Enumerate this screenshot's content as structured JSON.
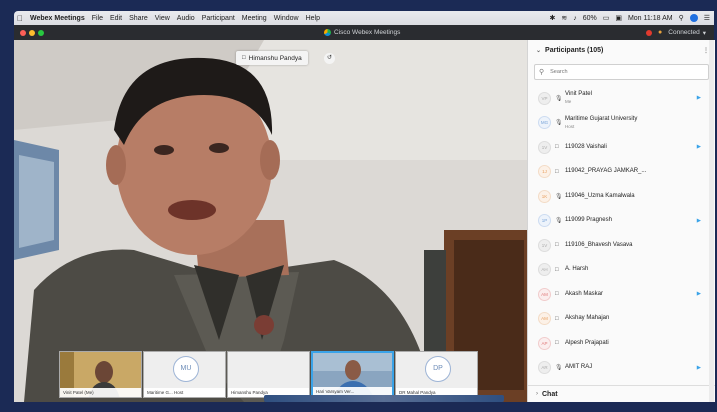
{
  "menubar": {
    "app": "Webex Meetings",
    "items": [
      "File",
      "Edit",
      "Share",
      "View",
      "Audio",
      "Participant",
      "Meeting",
      "Window",
      "Help"
    ],
    "battery": "60%",
    "clock": "Mon 11:18 AM"
  },
  "window": {
    "title": "Cisco Webex Meetings",
    "status": "Connected"
  },
  "video": {
    "speaker": "Himanshu Pandya"
  },
  "thumbnails": [
    {
      "initials": "",
      "name": "Vinit Patel (Me)",
      "active": false
    },
    {
      "initials": "MU",
      "name": "Maritime G... Host",
      "active": false
    },
    {
      "initials": "",
      "name": "Himanshu Pandya",
      "active": false
    },
    {
      "initials": "",
      "name": "Hari Varsyam Ver...",
      "active": true
    },
    {
      "initials": "DP",
      "name": "DR Mahal Pandya",
      "active": false
    }
  ],
  "participants": {
    "title": "Participants (105)",
    "search_placeholder": "Search",
    "list": [
      {
        "initials": "VP",
        "status": "mic",
        "name": "Vinit Patel",
        "role": "Me",
        "color": "gray",
        "camera": true
      },
      {
        "initials": "MG",
        "status": "mic",
        "name": "Maritime Gujarat University",
        "role": "Host",
        "color": "blue",
        "camera": false
      },
      {
        "initials": "1V",
        "status": "phone",
        "name": "119028 Vaishali",
        "role": "",
        "color": "gray",
        "camera": true
      },
      {
        "initials": "1J",
        "status": "phone",
        "name": "119042_PRAYAG JAMKAR_...",
        "role": "",
        "color": "orange",
        "camera": false
      },
      {
        "initials": "1K",
        "status": "mic",
        "name": "119046_Uzma Kamalwala",
        "role": "",
        "color": "orange",
        "camera": false
      },
      {
        "initials": "1P",
        "status": "mic",
        "name": "119099 Pragnesh",
        "role": "",
        "color": "blue",
        "camera": true
      },
      {
        "initials": "1V",
        "status": "phone",
        "name": "119106_Bhavesh Vasava",
        "role": "",
        "color": "gray",
        "camera": false
      },
      {
        "initials": "AH",
        "status": "phone",
        "name": "A. Harsh",
        "role": "",
        "color": "gray",
        "camera": false
      },
      {
        "initials": "AM",
        "status": "phone",
        "name": "Akash Maskar",
        "role": "",
        "color": "red",
        "camera": true
      },
      {
        "initials": "AM",
        "status": "phone",
        "name": "Akshay Mahajan",
        "role": "",
        "color": "orange",
        "camera": false
      },
      {
        "initials": "AP",
        "status": "phone",
        "name": "Alpesh Prajapati",
        "role": "",
        "color": "red",
        "camera": false
      },
      {
        "initials": "AR",
        "status": "mic",
        "name": "AMIT RAJ",
        "role": "",
        "color": "gray",
        "camera": true
      }
    ]
  },
  "chat": {
    "label": "Chat"
  }
}
